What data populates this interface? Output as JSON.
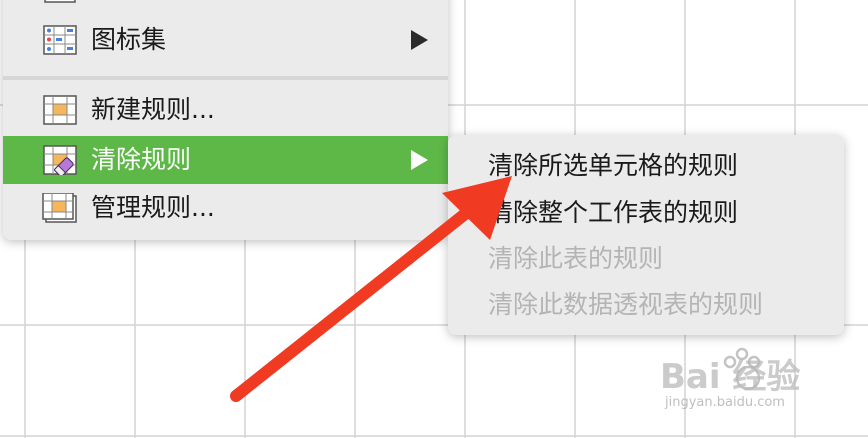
{
  "menu": {
    "items": [
      {
        "label": "图标集",
        "icon": "icon-sets-icon",
        "has_submenu": true
      },
      {
        "label": "新建规则...",
        "icon": "new-rule-icon",
        "has_submenu": false
      },
      {
        "label": "清除规则",
        "icon": "clear-rules-icon",
        "has_submenu": true,
        "selected": true
      },
      {
        "label": "管理规则...",
        "icon": "manage-rules-icon",
        "has_submenu": false
      }
    ]
  },
  "submenu": {
    "items": [
      {
        "label": "清除所选单元格的规则",
        "enabled": true
      },
      {
        "label": "清除整个工作表的规则",
        "enabled": true
      },
      {
        "label": "清除此表的规则",
        "enabled": false
      },
      {
        "label": "清除此数据透视表的规则",
        "enabled": false
      }
    ]
  },
  "watermark": {
    "logo_text": "Bai 经验",
    "url": "jingyan.baidu.com"
  },
  "colors": {
    "selected_bg": "#5eb848",
    "menu_bg": "#ebebeb",
    "arrow": "#f03a22"
  }
}
